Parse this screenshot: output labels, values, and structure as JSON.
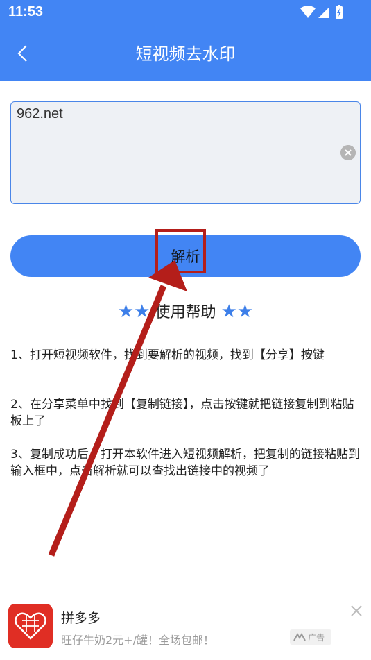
{
  "status_bar": {
    "time": "11:53"
  },
  "app_bar": {
    "title": "短视频去水印"
  },
  "input": {
    "value": "962.net"
  },
  "parse_button": {
    "label": "解析"
  },
  "help": {
    "title": "使用帮助",
    "stars_left": "★★",
    "stars_right": "★★",
    "steps": [
      "1、打开短视频软件，找到要解析的视频，找到【分享】按键",
      "2、在分享菜单中找到【复制链接】，点击按键就把链接复制到粘贴板上了",
      "3、复制成功后，打开本软件进入短视频解析，把复制的链接粘贴到输入框中，点击解析就可以查找出链接中的视频了"
    ]
  },
  "ad": {
    "name": "拼多多",
    "description": "旺仔牛奶2元+/罐！全场包邮！",
    "tag": "广告"
  },
  "colors": {
    "primary": "#4285f4",
    "annotation": "#b41e1a"
  },
  "icons": [
    "back-arrow-icon",
    "wifi-icon",
    "signal-icon",
    "battery-icon",
    "clear-icon",
    "close-icon",
    "pinduoduo-logo"
  ]
}
